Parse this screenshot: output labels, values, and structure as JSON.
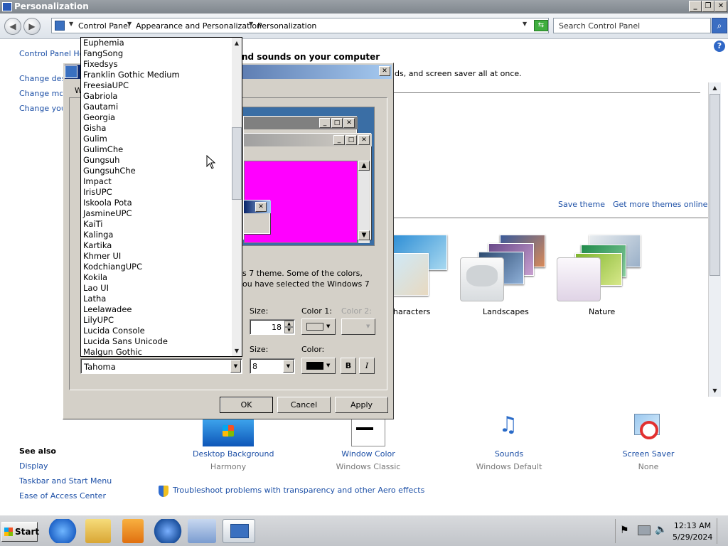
{
  "window": {
    "title": "Personalization",
    "controls": {
      "minimize": "_",
      "restore": "❐",
      "close": "✕"
    }
  },
  "nav": {
    "back": "◀",
    "forward": "▶",
    "breadcrumbs": [
      "Control Panel",
      "Appearance and Personalization",
      "Personalization"
    ],
    "search_placeholder": "Search Control Panel"
  },
  "sidebar": {
    "home": "Control Panel Hom",
    "links": [
      "Change desk",
      "Change mou",
      "Change your"
    ],
    "see_also": "See also",
    "see_also_links": [
      "Display",
      "Taskbar and Start Menu",
      "Ease of Access Center"
    ]
  },
  "main": {
    "heading_fragment": "nd sounds on your computer",
    "subtext_fragment": "ds, and screen saver all at once.",
    "save_theme": "Save theme",
    "get_more_themes": "Get more themes online",
    "themes": [
      {
        "label": "haracters"
      },
      {
        "label": "Landscapes"
      },
      {
        "label": "Nature"
      }
    ],
    "bottom_items": [
      {
        "title": "Desktop Background",
        "value": "Harmony"
      },
      {
        "title": "Window Color",
        "value": "Windows Classic"
      },
      {
        "title": "Sounds",
        "value": "Windows Default"
      },
      {
        "title": "Screen Saver",
        "value": "None"
      }
    ],
    "troubleshoot": "Troubleshoot problems with transparency and other Aero effects"
  },
  "dialog": {
    "close": "✕",
    "item_label_fragment": "W",
    "desc_line1": "s 7 theme.  Some of the colors,",
    "desc_line2": "ou have selected the Windows 7",
    "size_label": "Size:",
    "size_value": "18",
    "color1_label": "Color 1:",
    "color2_label": "Color 2:",
    "font_size_label": "Size:",
    "font_size_value": "8",
    "font_color_label": "Color:",
    "bold": "B",
    "italic": "I",
    "font_selected": "Tahoma",
    "ok": "OK",
    "cancel": "Cancel",
    "apply": "Apply",
    "fonts": [
      "Euphemia",
      "FangSong",
      "Fixedsys",
      "Franklin Gothic Medium",
      "FreesiaUPC",
      "Gabriola",
      "Gautami",
      "Georgia",
      "Gisha",
      "Gulim",
      "GulimChe",
      "Gungsuh",
      "GungsuhChe",
      "Impact",
      "IrisUPC",
      "Iskoola Pota",
      "JasmineUPC",
      "KaiTi",
      "Kalinga",
      "Kartika",
      "Khmer UI",
      "KodchiangUPC",
      "Kokila",
      "Lao UI",
      "Latha",
      "Leelawadee",
      "LilyUPC",
      "Lucida Console",
      "Lucida Sans Unicode",
      "Malgun Gothic"
    ]
  },
  "taskbar": {
    "start": "Start",
    "time": "12:13 AM",
    "date": "5/29/2024"
  },
  "colors": {
    "accent_link": "#1c4fa6",
    "preview_magenta": "#ff00ff",
    "preview_desktop": "#3a6ea5",
    "dialog_face": "#d4d0c8"
  }
}
